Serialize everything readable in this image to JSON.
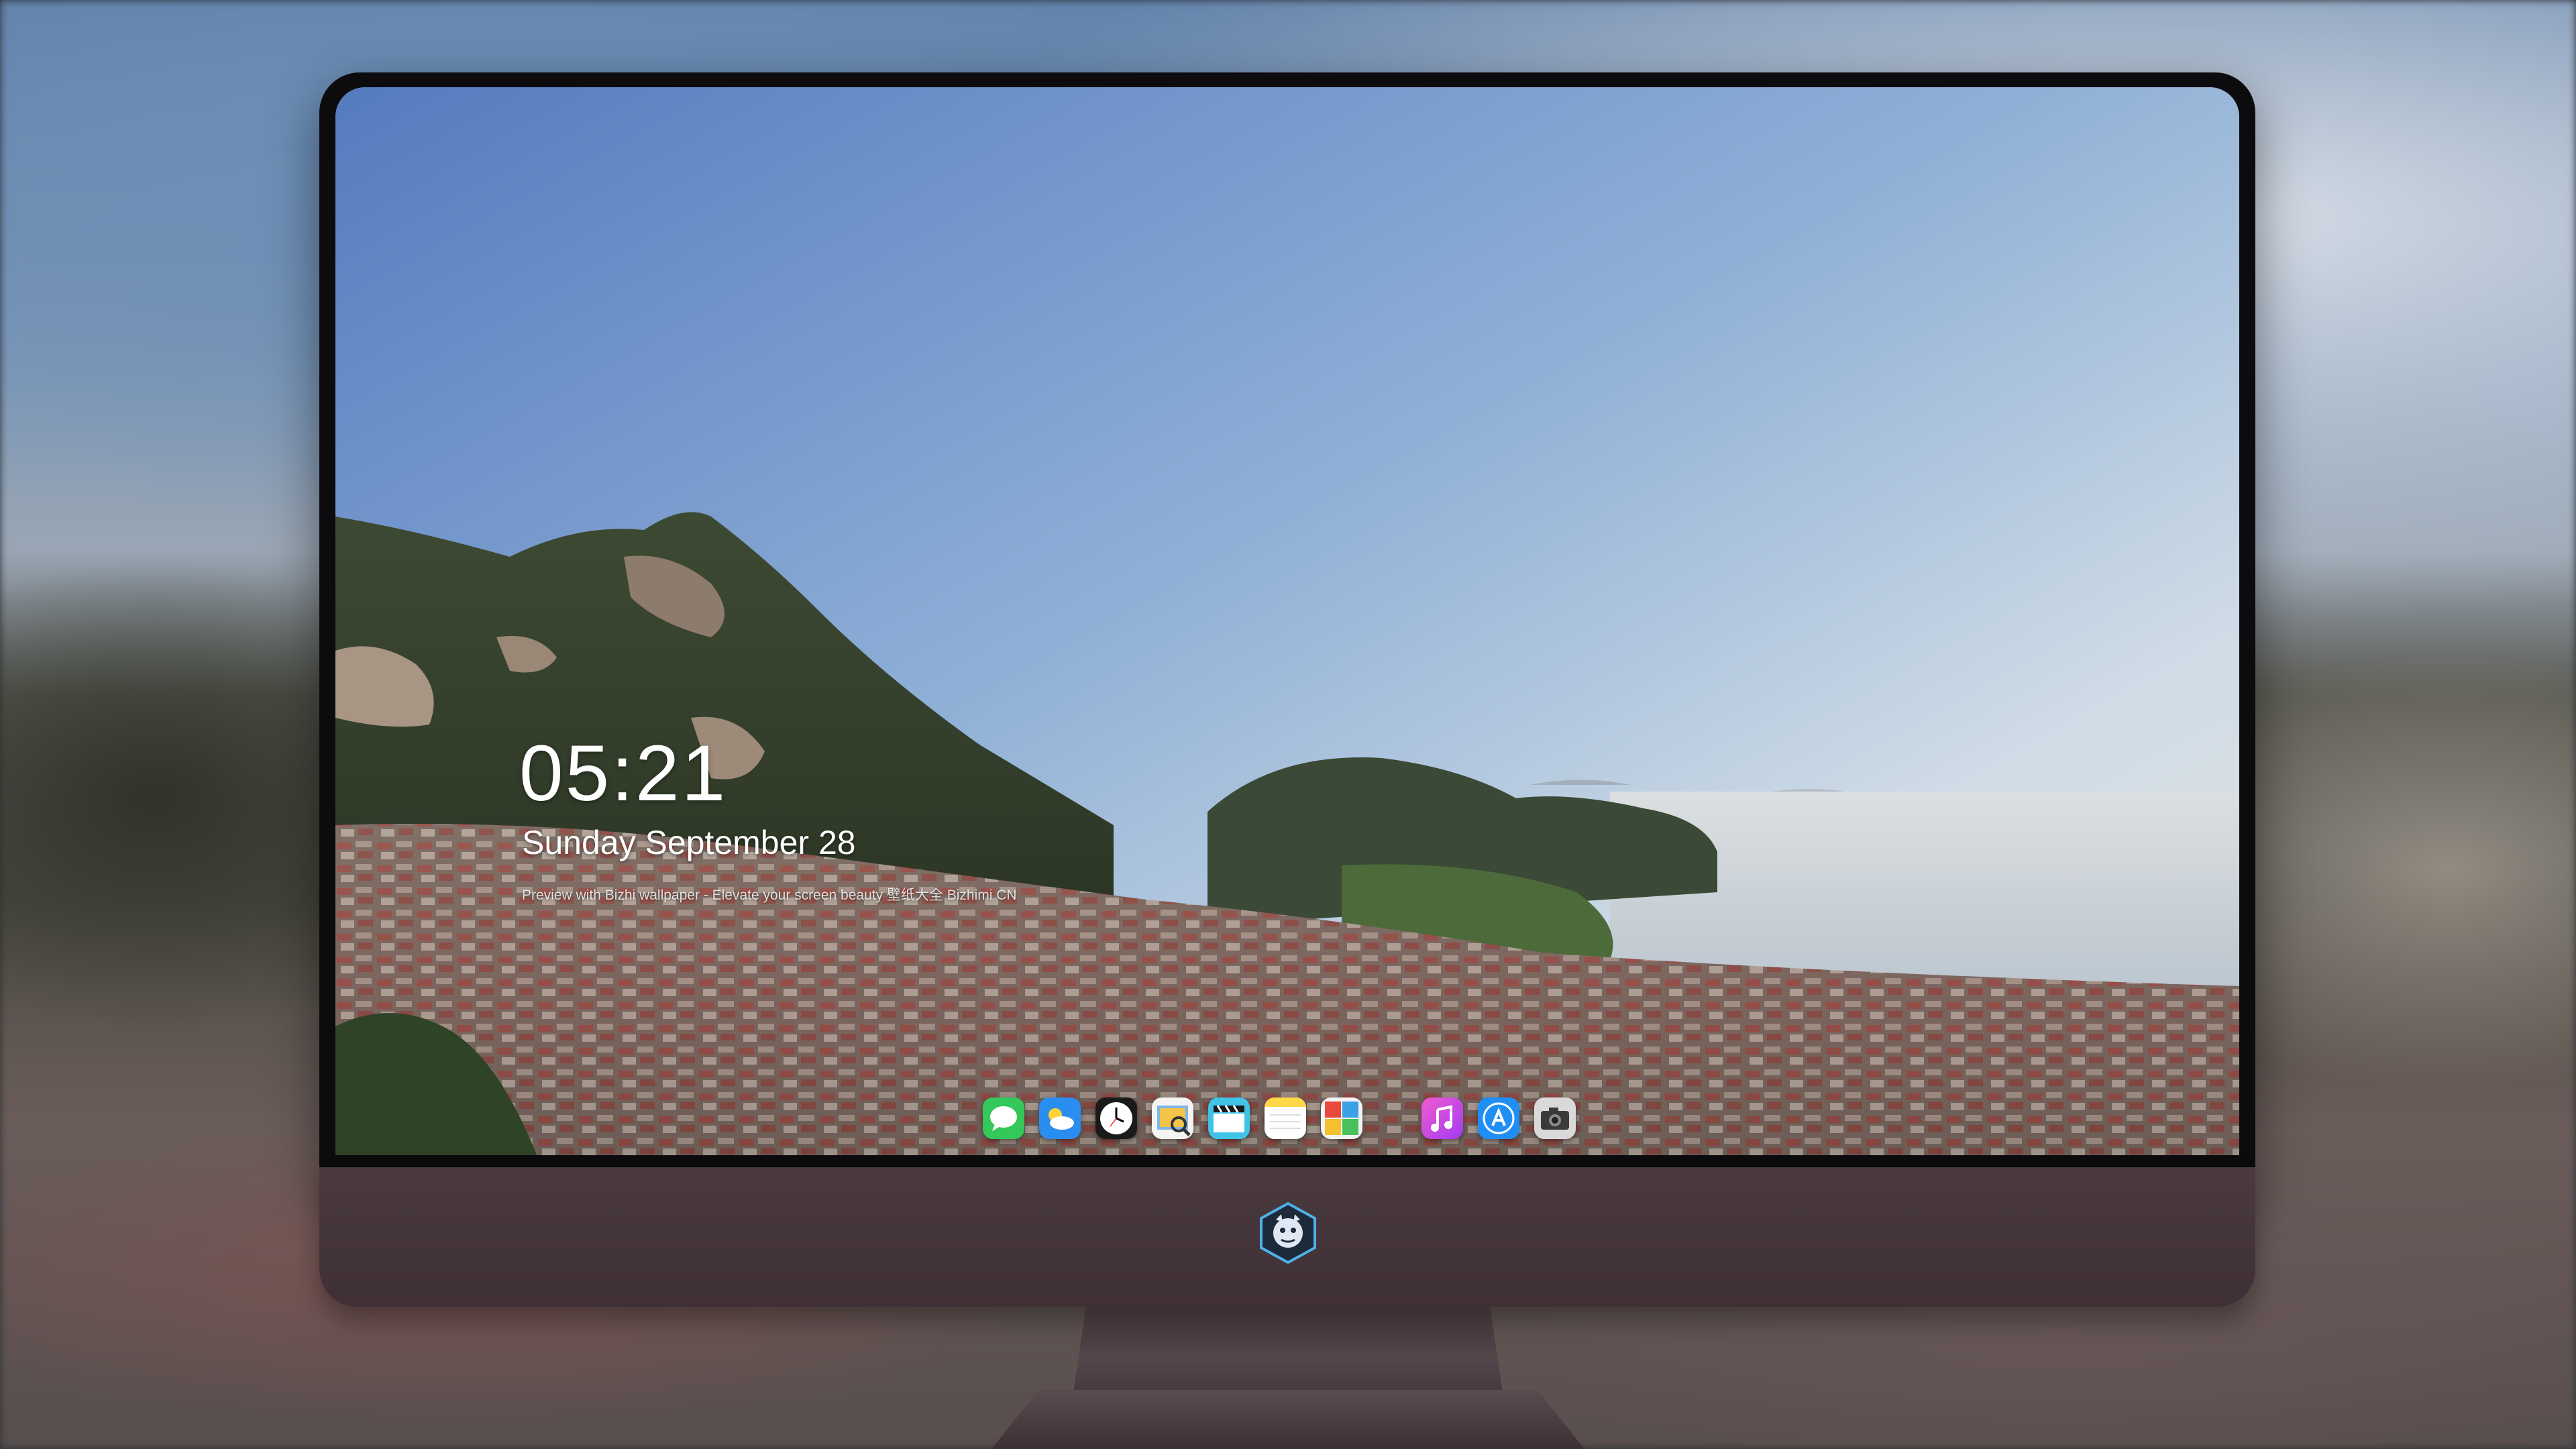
{
  "lock_screen": {
    "time": "05:21",
    "date": "Sunday  September  28",
    "tagline": "Preview with Bizhi wallpaper - Elevate your screen beauty  壁纸大全 Bizhimi CN"
  },
  "dock": {
    "apps": [
      {
        "name": "Messages",
        "icon": "messages-icon"
      },
      {
        "name": "Weather",
        "icon": "weather-icon"
      },
      {
        "name": "Clock",
        "icon": "clock-icon"
      },
      {
        "name": "Preview",
        "icon": "preview-icon"
      },
      {
        "name": "Clips",
        "icon": "clapper-icon"
      },
      {
        "name": "Notes",
        "icon": "notes-icon"
      },
      {
        "name": "Photo Booth",
        "icon": "photo-booth-icon"
      },
      {
        "name": "iTunes",
        "icon": "music-note-icon"
      },
      {
        "name": "App Store",
        "icon": "app-store-icon"
      },
      {
        "name": "Camera",
        "icon": "camera-icon"
      }
    ]
  },
  "colors": {
    "bezel": "#0c0c0e",
    "chin": "#4a3a3f",
    "sky_top": "#5a7fbf",
    "sea": "#b8c6d2"
  }
}
